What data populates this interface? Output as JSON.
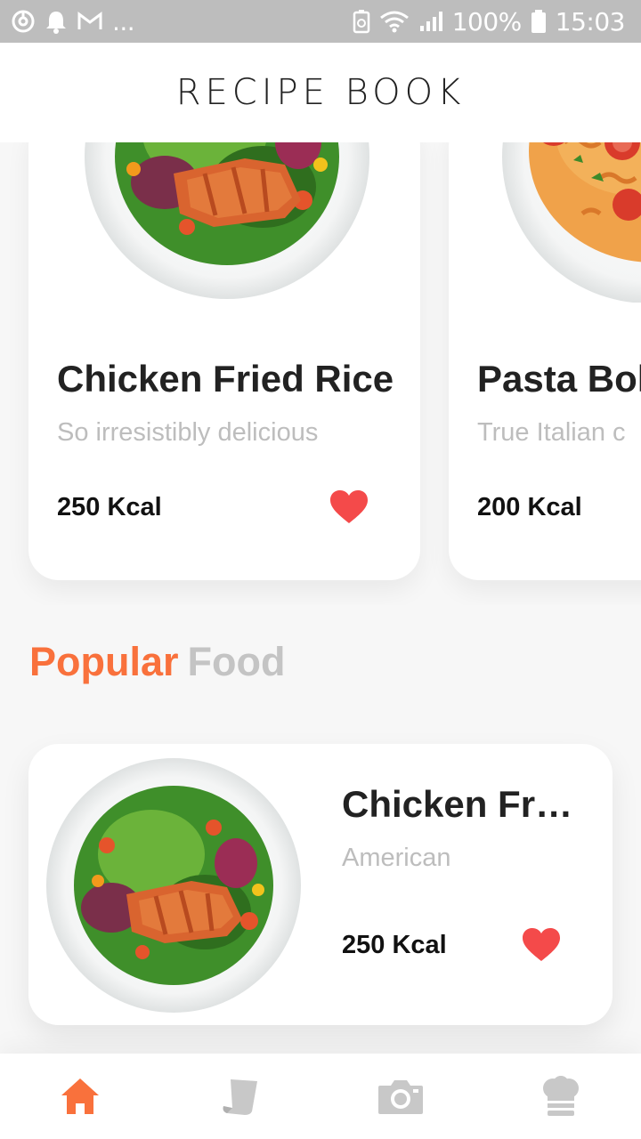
{
  "status_bar": {
    "icons_left": [
      "sync-icon",
      "bell-icon",
      "gmail-icon"
    ],
    "more_text": "...",
    "icons_right": [
      "battery-saver-icon",
      "wifi-icon",
      "signal-icon",
      "battery-icon"
    ],
    "battery": "100%",
    "time": "15:03"
  },
  "header": {
    "title": "RECIPE BOOK"
  },
  "featured": [
    {
      "title": "Chicken Fried Rice",
      "subtitle": "So irresistibly delicious",
      "kcal": "250 Kcal",
      "favorite": true
    },
    {
      "title": "Pasta Bol",
      "subtitle": "True Italian c",
      "kcal": "200 Kcal",
      "favorite": false
    }
  ],
  "popular": {
    "title_highlight": "Popular",
    "title_rest": "Food",
    "items": [
      {
        "title": "Chicken Fried Rice",
        "subtitle": "American",
        "kcal": "250 Kcal",
        "favorite": true
      }
    ]
  },
  "bottom_nav": {
    "items": [
      {
        "icon": "home-icon",
        "active": true
      },
      {
        "icon": "recipe-page-icon",
        "active": false
      },
      {
        "icon": "camera-icon",
        "active": false
      },
      {
        "icon": "chef-hat-icon",
        "active": false
      }
    ]
  },
  "colors": {
    "accent": "#f9713c",
    "heart": "#f44a4a",
    "muted_text": "#bdbdbd",
    "inactive_icon": "#c8c8c8",
    "status_bar": "#bdbdbd"
  }
}
